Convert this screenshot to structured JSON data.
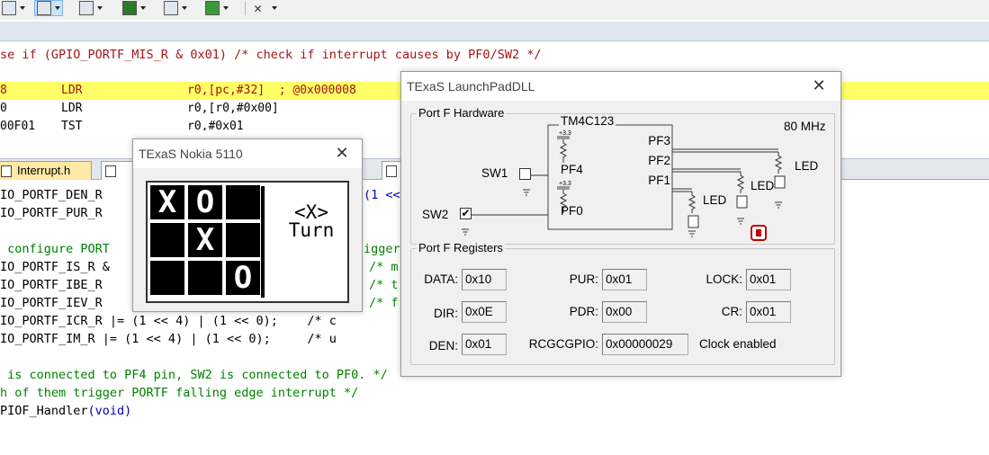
{
  "code_top": {
    "if_line": {
      "prefix": "se if (GPIO_PORTF_MIS_R & 0x01) ",
      "comment": "/* check if interrupt causes by PF0/SW2 */"
    }
  },
  "disassembly": [
    {
      "addr": "8",
      "mnemonic": "LDR",
      "operands": "r0,[pc,#32]  ; @0x000008"
    },
    {
      "addr": "0",
      "mnemonic": "LDR",
      "operands": "r0,[r0,#0x00]"
    },
    {
      "addr": "00F01",
      "mnemonic": "TST",
      "operands": "r0,#0x01"
    }
  ],
  "tabs": {
    "interrupt_h": "Interrupt.h"
  },
  "code_editor": {
    "lines": [
      {
        "text": "IO_PORTF_DEN_R"
      },
      {
        "text": "IO_PORTF_PUR_R"
      },
      {
        "text": ""
      },
      {
        "text": " configure PORT"
      },
      {
        "text": "IO_PORTF_IS_R &"
      },
      {
        "text": "IO_PORTF_IBE_R"
      },
      {
        "text": "IO_PORTF_IEV_R"
      },
      {
        "text": "IO_PORTF_ICR_R |= (1 << 4) | (1 << 0);    /* c"
      },
      {
        "text": "IO_PORTF_IM_R |= (1 << 4) | (1 << 0);     /* u"
      }
    ],
    "right_fragments": {
      "l0": "(1 <<",
      "l3": "igger",
      "l4": "/* m",
      "l5": "/* t",
      "l6": "/* f"
    },
    "comment1": " is connected to PF4 pin, SW2 is connected to PF0. */",
    "comment2": "h of them trigger PORTF falling edge interrupt */",
    "handler": {
      "name": "PIOF_Handler",
      "args": "(void)"
    }
  },
  "nokia": {
    "title": "TExaS Nokia 5110",
    "close": "✕",
    "board": [
      "X",
      "O",
      "",
      "",
      "X",
      "",
      "",
      "",
      "O"
    ],
    "status_line1": "<X>",
    "status_line2": "Turn"
  },
  "launchpad": {
    "title": "TExaS LaunchPadDLL",
    "close": "✕",
    "hardware": {
      "group_label": "Port F Hardware",
      "chip": "TM4C123",
      "clock": "80 MHz",
      "sw1": "SW1",
      "sw2": "SW2",
      "pf4": "PF4",
      "pf0": "PF0",
      "pf3": "PF3",
      "pf2": "PF2",
      "pf1": "PF1",
      "led": "LED",
      "vcc": "+3.3",
      "sw1_checked": false,
      "sw2_checked": true
    },
    "registers": {
      "group_label": "Port F Registers",
      "data_label": "DATA:",
      "data": "0x10",
      "pur_label": "PUR:",
      "pur": "0x01",
      "lock_label": "LOCK:",
      "lock": "0x01",
      "dir_label": "DIR:",
      "dir": "0x0E",
      "pdr_label": "PDR:",
      "pdr": "0x00",
      "cr_label": "CR:",
      "cr": "0x01",
      "den_label": "DEN:",
      "den": "0x01",
      "rcgc_label": "RCGCGPIO:",
      "rcgc": "0x00000029",
      "clock_status": "Clock enabled"
    }
  }
}
